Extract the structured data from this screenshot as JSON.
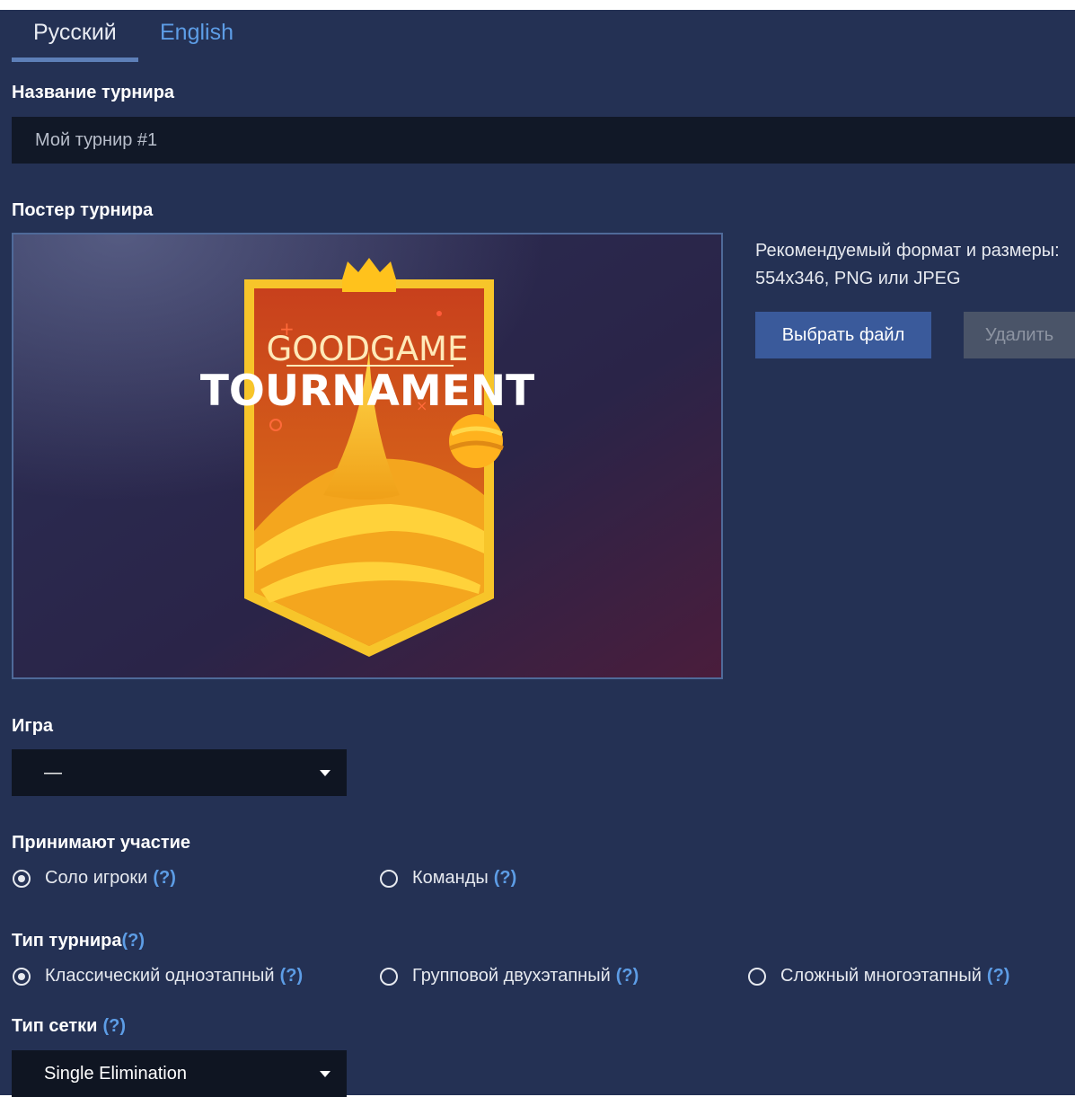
{
  "tabs": [
    {
      "label": "Русский"
    },
    {
      "label": "English"
    }
  ],
  "name_section": {
    "label": "Название турнира",
    "value": "Мой турнир #1"
  },
  "poster_section": {
    "label": "Постер турнира",
    "image_text": {
      "line1": "GOODGAME",
      "line2": "TOURNAMENT"
    },
    "hint": "Рекомендуемый формат и размеры: 554x346, PNG или JPEG",
    "choose_button": "Выбрать файл",
    "delete_button": "Удалить"
  },
  "game_section": {
    "label": "Игра",
    "selected": "—"
  },
  "participants_section": {
    "label": "Принимают участие",
    "options": [
      {
        "label": "Соло игроки",
        "help": "(?)",
        "selected": true
      },
      {
        "label": "Команды",
        "help": "(?)",
        "selected": false
      }
    ]
  },
  "tournament_type_section": {
    "label": "Тип турнира",
    "help": "(?)",
    "options": [
      {
        "label": "Классический одноэтапный",
        "help": "(?)",
        "selected": true
      },
      {
        "label": "Групповой двухэтапный",
        "help": "(?)",
        "selected": false
      },
      {
        "label": "Сложный многоэтапный",
        "help": "(?)",
        "selected": false
      }
    ]
  },
  "bracket_section": {
    "label": "Тип сетки",
    "help": "(?)",
    "selected": "Single Elimination"
  },
  "colors": {
    "background": "#243154",
    "accent": "#5d9de6",
    "primary_button": "#3a5a9b",
    "disabled_button": "#4a5468",
    "input": "#111827"
  }
}
